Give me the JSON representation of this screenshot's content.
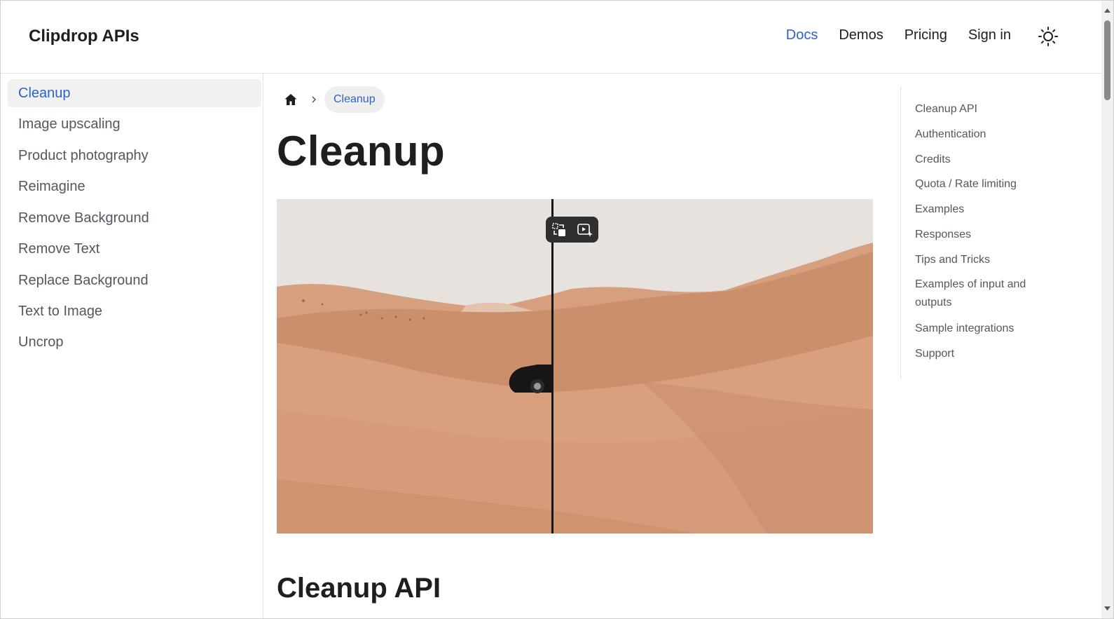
{
  "navbar": {
    "brand": "Clipdrop APIs",
    "links": [
      {
        "label": "Docs",
        "active": true
      },
      {
        "label": "Demos",
        "active": false
      },
      {
        "label": "Pricing",
        "active": false
      },
      {
        "label": "Sign in",
        "active": false
      }
    ],
    "theme_icon": "sun-icon"
  },
  "sidebar": {
    "items": [
      {
        "label": "Cleanup",
        "active": true
      },
      {
        "label": "Image upscaling"
      },
      {
        "label": "Product photography"
      },
      {
        "label": "Reimagine"
      },
      {
        "label": "Remove Background"
      },
      {
        "label": "Remove Text"
      },
      {
        "label": "Replace Background"
      },
      {
        "label": "Text to Image"
      },
      {
        "label": "Uncrop"
      }
    ]
  },
  "breadcrumb": {
    "home_icon": "home-icon",
    "separator_icon": "chevron-right-icon",
    "current": "Cleanup"
  },
  "main": {
    "title": "Cleanup",
    "compare_controls": [
      "swap-compare-icon",
      "play-magic-icon"
    ],
    "section_title": "Cleanup API"
  },
  "toc": {
    "items": [
      "Cleanup API",
      "Authentication",
      "Credits",
      "Quota / Rate limiting",
      "Examples",
      "Responses",
      "Tips and Tricks",
      "Examples of input and outputs",
      "Sample integrations",
      "Support"
    ]
  },
  "colors": {
    "accent": "#2e62c9",
    "text": "#1c1e21",
    "muted": "#525860",
    "sand": "#d89b76",
    "sky": "#e8e2df"
  }
}
